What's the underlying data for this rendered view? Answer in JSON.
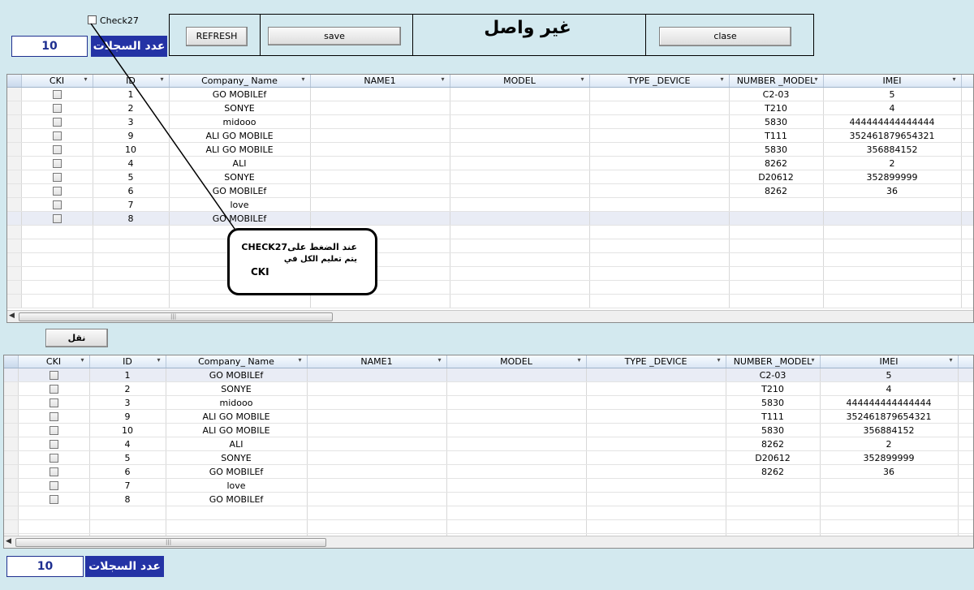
{
  "top": {
    "check_label": "Check27",
    "count_value": "10",
    "count_label": "عدد السجلات",
    "refresh_label": "REFRESH",
    "save_label": "save",
    "status_text": "غير واصل",
    "close_label": "clase"
  },
  "columns": [
    "CKI",
    "ID",
    "Company_ Name",
    "NAME1",
    "MODEL",
    "TYPE _DEVICE",
    "NUMBER _MODEL",
    "IMEI"
  ],
  "rows": [
    {
      "id": "1",
      "company": "GO MOBILEf",
      "number_model": "C2-03",
      "imei": "5"
    },
    {
      "id": "2",
      "company": "SONYE",
      "number_model": "T210",
      "imei": "4"
    },
    {
      "id": "3",
      "company": "midooo",
      "number_model": "5830",
      "imei": "444444444444444"
    },
    {
      "id": "9",
      "company": "ALI GO MOBILE",
      "number_model": "T111",
      "imei": "352461879654321"
    },
    {
      "id": "10",
      "company": "ALI GO MOBILE",
      "number_model": "5830",
      "imei": "356884152"
    },
    {
      "id": "4",
      "company": "ALI",
      "number_model": "8262",
      "imei": "2"
    },
    {
      "id": "5",
      "company": "SONYE",
      "number_model": "D20612",
      "imei": "352899999"
    },
    {
      "id": "6",
      "company": "GO MOBILEf",
      "number_model": "8262",
      "imei": "36"
    },
    {
      "id": "7",
      "company": "love",
      "number_model": "",
      "imei": ""
    },
    {
      "id": "8",
      "company": "GO MOBILEf",
      "number_model": "",
      "imei": ""
    }
  ],
  "callout": {
    "line1": "عند الضغط علىCHECK27",
    "line2": "يتم تعليم الكل في",
    "line3": "CKI"
  },
  "transfer_label": "نقل",
  "bottom": {
    "count_value": "10",
    "count_label": "عدد السجلات"
  },
  "colors": {
    "background": "#d3e9ef",
    "label_blue": "#2433a5",
    "count_text": "#1e2f90"
  }
}
